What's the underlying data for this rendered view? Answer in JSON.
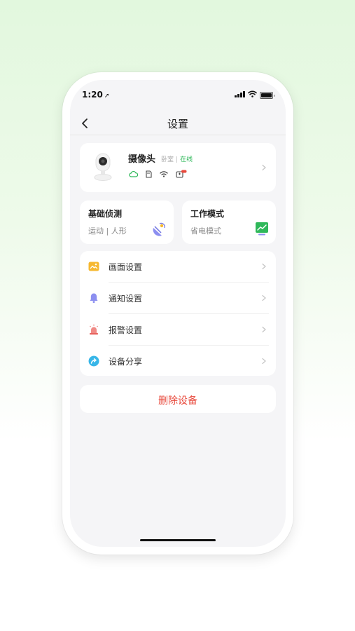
{
  "status_bar": {
    "time": "1:20",
    "location_glyph": "➚"
  },
  "nav": {
    "title": "设置",
    "back_icon": "chevron-left"
  },
  "device": {
    "name": "摄像头",
    "room": "卧室",
    "separator": "|",
    "status": "在线",
    "status_color": "#2fb85a",
    "icons": [
      "cloud-icon",
      "sd-card-icon",
      "wifi-icon",
      "battery-badge-icon"
    ]
  },
  "basic_detection": {
    "title": "基础侦测",
    "subtitle": "运动 | 人形"
  },
  "work_mode": {
    "title": "工作模式",
    "subtitle": "省电模式"
  },
  "menu": {
    "items": [
      {
        "label": "画面设置",
        "icon": "image-icon",
        "color": "#f6b830"
      },
      {
        "label": "通知设置",
        "icon": "bell-icon",
        "color": "#8c8ff0"
      },
      {
        "label": "报警设置",
        "icon": "alarm-icon",
        "color": "#f08a86"
      },
      {
        "label": "设备分享",
        "icon": "share-icon",
        "color": "#38b6e8"
      }
    ]
  },
  "delete_label": "删除设备",
  "colors": {
    "accent_green": "#2fb85a",
    "danger": "#e8483b",
    "background": "#f5f5f7"
  }
}
